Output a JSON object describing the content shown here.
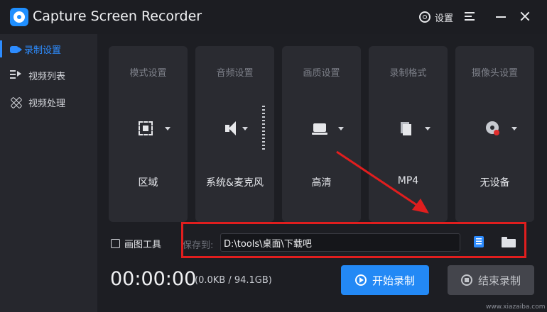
{
  "app": {
    "title": "Capture Screen Recorder",
    "settings_label": "设置"
  },
  "sidebar": {
    "items": [
      {
        "label": "录制设置",
        "icon": "camera-icon",
        "active": true
      },
      {
        "label": "视频列表",
        "icon": "video-list-icon",
        "active": false
      },
      {
        "label": "视频处理",
        "icon": "tools-icon",
        "active": false
      }
    ]
  },
  "cards": [
    {
      "title": "模式设置",
      "value": "区域",
      "icon": "region-icon"
    },
    {
      "title": "音频设置",
      "value": "系统&麦克风",
      "icon": "speaker-icon"
    },
    {
      "title": "画质设置",
      "value": "高清",
      "icon": "laptop-icon"
    },
    {
      "title": "录制格式",
      "value": "MP4",
      "icon": "file-icon"
    },
    {
      "title": "摄像头设置",
      "value": "无设备",
      "icon": "webcam-icon"
    }
  ],
  "save": {
    "draw_tool_label": "画图工具",
    "draw_tool_checked": false,
    "save_to_label": "保存到:",
    "path_value": "D:\\tools\\桌面\\下载吧"
  },
  "recording": {
    "timer": "00:00:00",
    "size_text": "(0.0KB / 94.1GB)",
    "start_label": "开始录制",
    "stop_label": "结束录制"
  },
  "colors": {
    "accent": "#2389f5",
    "annotation_red": "#e01e1e",
    "background": "#1e1f24"
  },
  "watermark": "www.xiazaiba.com"
}
